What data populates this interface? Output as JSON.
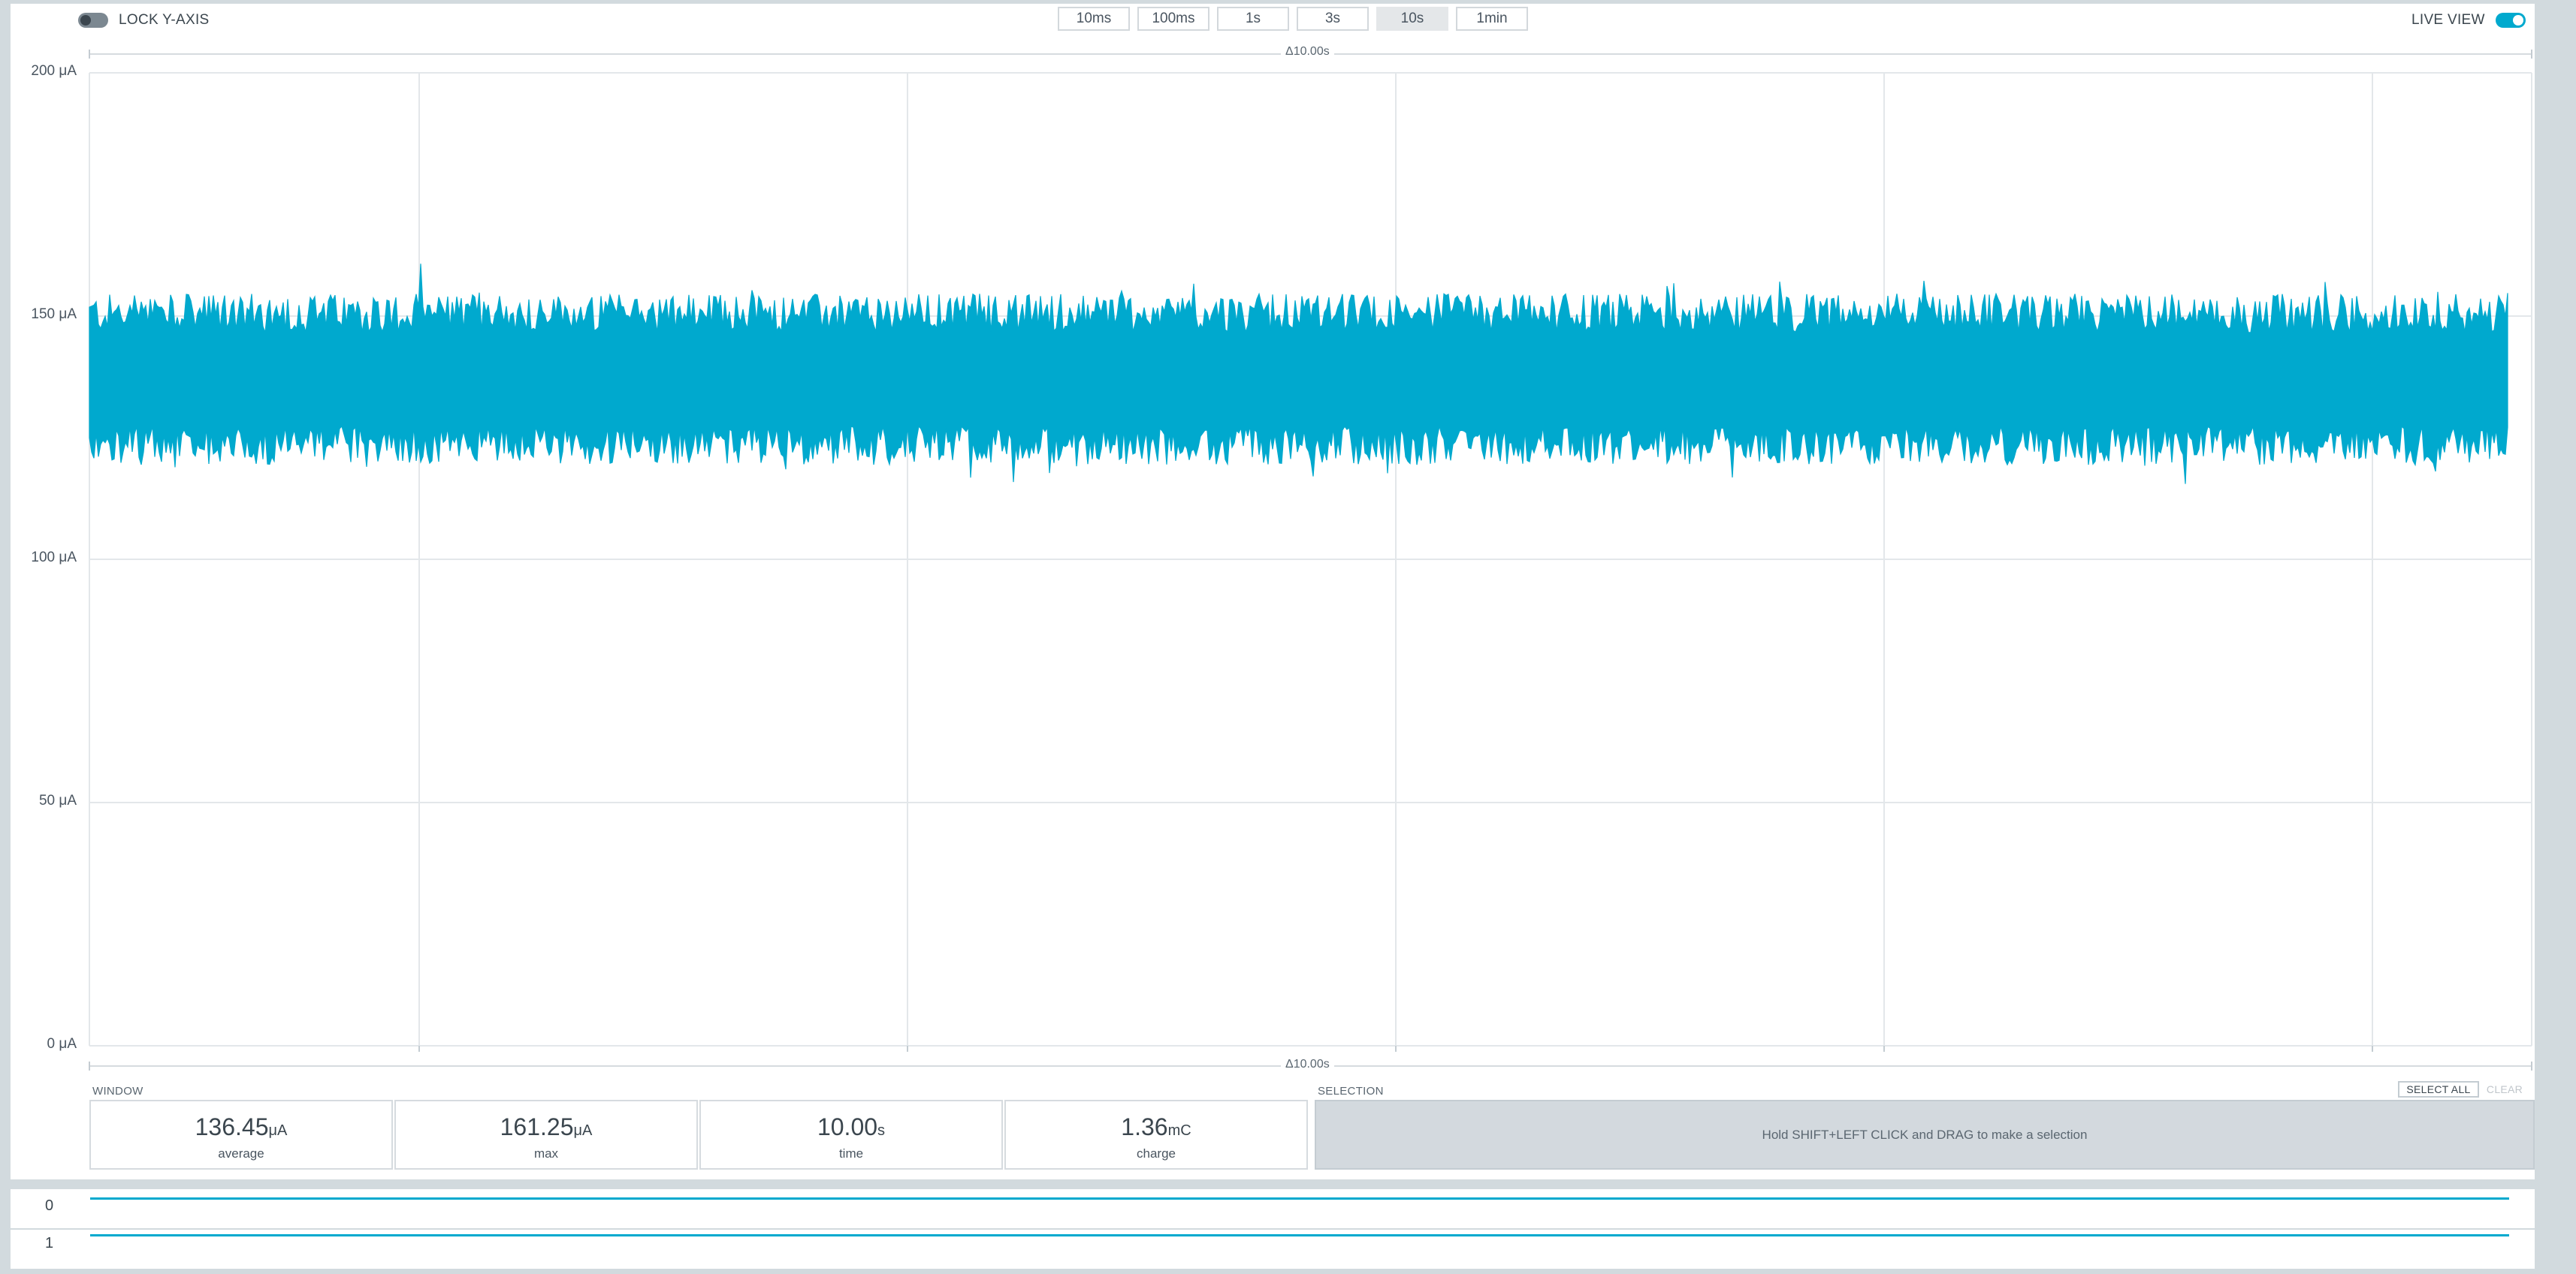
{
  "toolbar": {
    "lock_y_axis_label": "LOCK Y-AXIS",
    "lock_y_axis_on": false,
    "live_view_label": "LIVE VIEW",
    "live_view_on": true,
    "window_buttons": [
      "10ms",
      "100ms",
      "1s",
      "3s",
      "10s",
      "1min"
    ],
    "active_window": "10s"
  },
  "chart_data": {
    "type": "area",
    "title": "",
    "xlabel": "",
    "ylabel": "",
    "ylim": [
      0,
      200
    ],
    "y_unit": "μA",
    "y_ticks": [
      "200 μA",
      "150 μA",
      "100 μA",
      "50 μA",
      "0 μA"
    ],
    "x_range_label": "Δ10.00s",
    "duration_s": 10,
    "grid": true,
    "series": [
      {
        "color": "#00a9ce",
        "mean": 136.45,
        "band": [
          125,
          149
        ],
        "max": 161.25,
        "min": 115
      }
    ]
  },
  "window_stats": {
    "label": "WINDOW",
    "items": [
      {
        "value": "136.45",
        "unit": "μA",
        "label": "average"
      },
      {
        "value": "161.25",
        "unit": "μA",
        "label": "max"
      },
      {
        "value": "10.00",
        "unit": "s",
        "label": "time"
      },
      {
        "value": "1.36",
        "unit": "mC",
        "label": "charge"
      }
    ]
  },
  "selection": {
    "label": "SELECTION",
    "select_all": "SELECT ALL",
    "clear": "CLEAR",
    "hint": "Hold SHIFT+LEFT CLICK and DRAG to make a selection"
  },
  "digital_channels": [
    {
      "label": "0"
    },
    {
      "label": "1"
    }
  ]
}
